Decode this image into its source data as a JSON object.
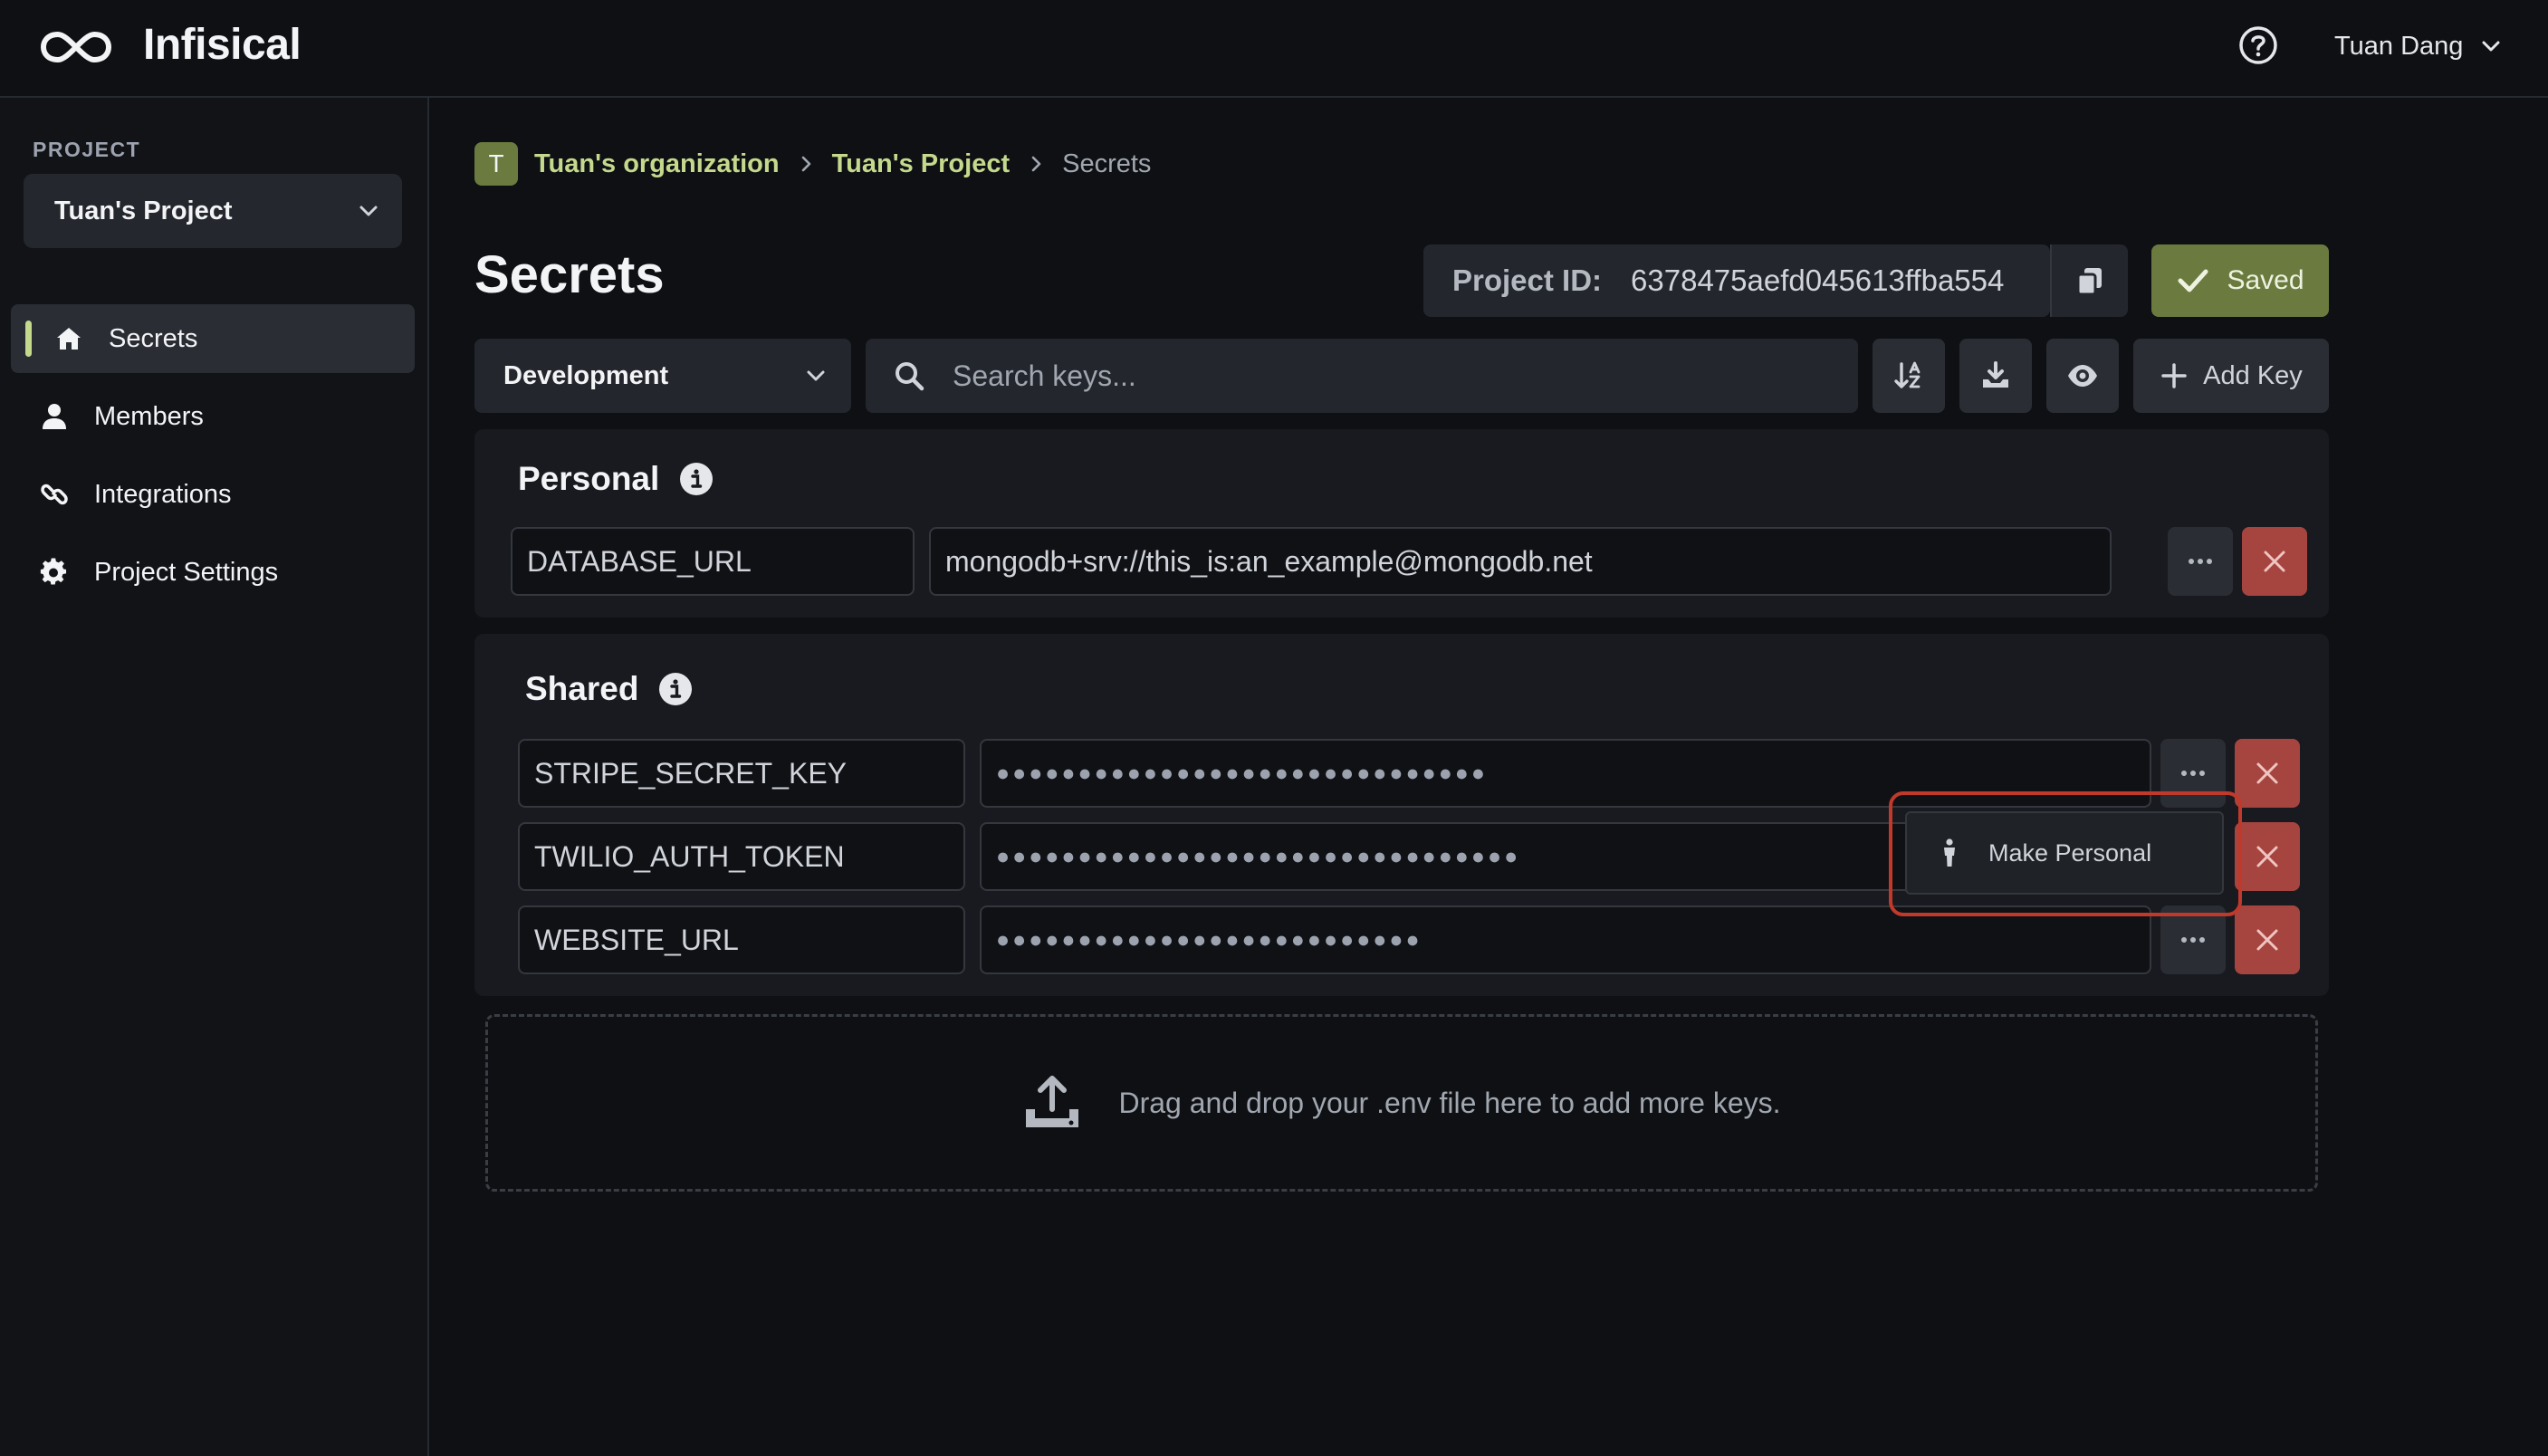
{
  "app": {
    "name": "Infisical"
  },
  "topbar": {
    "user_name": "Tuan Dang"
  },
  "sidebar": {
    "caption": "PROJECT",
    "project_selected": "Tuan's Project",
    "items": [
      {
        "label": "Secrets",
        "icon": "home-icon",
        "active": true
      },
      {
        "label": "Members",
        "icon": "user-icon",
        "active": false
      },
      {
        "label": "Integrations",
        "icon": "link-icon",
        "active": false
      },
      {
        "label": "Project Settings",
        "icon": "gear-icon",
        "active": false
      }
    ]
  },
  "breadcrumb": {
    "org_initial": "T",
    "org": "Tuan's organization",
    "project": "Tuan's Project",
    "current": "Secrets"
  },
  "page": {
    "title": "Secrets",
    "project_id_label": "Project ID:",
    "project_id": "6378475aefd045613ffba554",
    "saved_label": "Saved"
  },
  "toolbar": {
    "environment": "Development",
    "search_placeholder": "Search keys...",
    "add_key_label": "Add Key"
  },
  "personal": {
    "title": "Personal",
    "secrets": [
      {
        "key": "DATABASE_URL",
        "value": "mongodb+srv://this_is:an_example@mongodb.net"
      }
    ]
  },
  "shared": {
    "title": "Shared",
    "secrets": [
      {
        "key": "STRIPE_SECRET_KEY",
        "masked": "●●●●●●●●●●●●●●●●●●●●●●●●●●●●●●"
      },
      {
        "key": "TWILIO_AUTH_TOKEN",
        "masked": "●●●●●●●●●●●●●●●●●●●●●●●●●●●●●●●●"
      },
      {
        "key": "WEBSITE_URL",
        "masked": "●●●●●●●●●●●●●●●●●●●●●●●●●●"
      }
    ]
  },
  "context_menu": {
    "make_personal_label": "Make Personal"
  },
  "dropzone": {
    "text": "Drag and drop your .env file here to add more keys."
  },
  "colors": {
    "accent": "#c5d98d",
    "saved_bg": "#6b7b3f",
    "danger": "#a6453f",
    "highlight": "#c0392b"
  }
}
